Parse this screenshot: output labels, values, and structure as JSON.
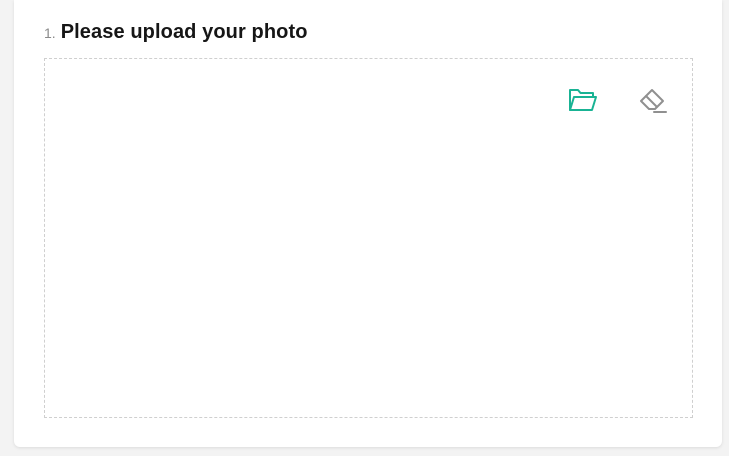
{
  "question": {
    "number": "1.",
    "title": "Please upload your photo"
  },
  "upload": {
    "choose_file_icon": "folder-open-icon",
    "clear_icon": "eraser-icon",
    "colors": {
      "choose_file": "#19b394",
      "clear": "#909090",
      "border": "#cfcfcf"
    }
  }
}
